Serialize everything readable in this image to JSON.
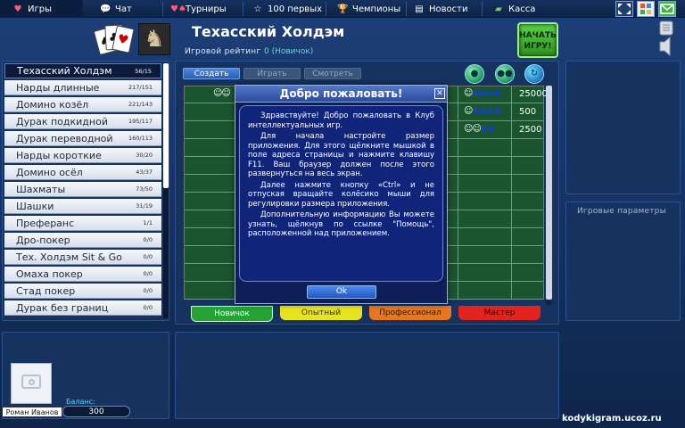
{
  "nav": {
    "tabs": [
      {
        "label": "Игры",
        "icon": "heart-icon",
        "active": true
      },
      {
        "label": "Чат",
        "icon": "chat-bubble-icon",
        "active": false
      },
      {
        "label": "Турниры",
        "icon": "card-suits-icon",
        "active": false
      },
      {
        "label": "100 первых",
        "icon": "star-icon",
        "active": false
      },
      {
        "label": "Чемпионы",
        "icon": "trophy-icon",
        "active": false
      },
      {
        "label": "Новости",
        "icon": "news-icon",
        "active": false
      },
      {
        "label": "Касса",
        "icon": "money-icon",
        "active": false
      }
    ],
    "tool_icons": [
      "fullscreen-icon",
      "settings-grid-icon",
      "mail-icon"
    ]
  },
  "header": {
    "title": "Техасский Холдэм",
    "rating_label": "Игровой рейтинг",
    "rating_value": "0 (Новичок)",
    "start_button": {
      "line1": "НАЧАТЬ",
      "line2": "ИГРУ!"
    }
  },
  "game_list": {
    "items": [
      {
        "name": "Техасский Холдэм",
        "count": "56/15",
        "active": true
      },
      {
        "name": "Нарды длинные",
        "count": "217/151",
        "active": false
      },
      {
        "name": "Домино козёл",
        "count": "221/143",
        "active": false
      },
      {
        "name": "Дурак подкидной",
        "count": "195/117",
        "active": false
      },
      {
        "name": "Дурак переводной",
        "count": "160/113",
        "active": false
      },
      {
        "name": "Нарды короткие",
        "count": "30/20",
        "active": false
      },
      {
        "name": "Домино осёл",
        "count": "43/37",
        "active": false
      },
      {
        "name": "Шахматы",
        "count": "73/50",
        "active": false
      },
      {
        "name": "Шашки",
        "count": "31/19",
        "active": false
      },
      {
        "name": "Преферанс",
        "count": "1/1",
        "active": false
      },
      {
        "name": "Дро-покер",
        "count": "0/0",
        "active": false
      },
      {
        "name": "Тех. Холдэм Sit & Go",
        "count": "0/0",
        "active": false
      },
      {
        "name": "Омаха покер",
        "count": "0/0",
        "active": false
      },
      {
        "name": "Стад покер",
        "count": "0/0",
        "active": false
      },
      {
        "name": "Дурак без границ",
        "count": "0/0",
        "active": false
      }
    ]
  },
  "tables": {
    "buttons": {
      "create": "Создать",
      "play": "Играть",
      "watch": "Смотреть"
    },
    "rows": [
      {
        "bet": "25000",
        "seats_taken": 1,
        "seats_total": 5
      },
      {
        "bet": "500",
        "seats_taken": 1,
        "seats_total": 5
      },
      {
        "bet": "2500",
        "seats_taken": 2,
        "seats_total": 4
      }
    ],
    "level_tabs": [
      {
        "label": "Новичок",
        "bg": "#25a335",
        "color": "#ffffff"
      },
      {
        "label": "Опытный",
        "bg": "#e8e320",
        "color": "#3a3a00"
      },
      {
        "label": "Профессионал",
        "bg": "#e7771f",
        "color": "#3b1800"
      },
      {
        "label": "Мастер",
        "bg": "#e3231d",
        "color": "#3b0000"
      }
    ]
  },
  "right_panel": {
    "params_title": "Игровые параметры"
  },
  "user": {
    "name": "Роман Иванов",
    "balance_label": "Баланс:",
    "balance": "300"
  },
  "site_url": "kodykigram.ucoz.ru",
  "modal": {
    "title": "Добро пожаловать!",
    "paragraphs": [
      "Здравствуйте! Добро пожаловать в Клуб интеллектуальных игр.",
      "Для начала настройте размер приложения. Для этого щёлкните мышкой в поле адреса страницы и нажмите клавишу F11. Ваш браузер должен после этого развернуться на весь экран.",
      "Далее нажмите кнопку «Ctrl» и не отпуская вращайте колёсико мыши для регулировки размера приложения.",
      "Дополнительную информацию Вы можете узнать, щёлкнув по ссылке \"Помощь\", расположенной над приложением."
    ],
    "ok_label": "Ok"
  }
}
